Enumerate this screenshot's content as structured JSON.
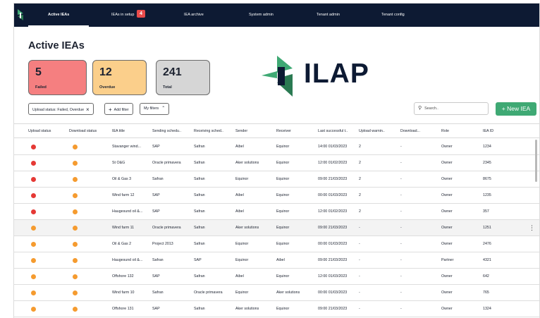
{
  "nav": {
    "tabs": [
      {
        "label": "Active IEAs"
      },
      {
        "label": "IEAs in setup",
        "badge": "4"
      },
      {
        "label": "IEA archive"
      },
      {
        "label": "System admin"
      },
      {
        "label": "Tenant admin"
      },
      {
        "label": "Tenant config"
      }
    ],
    "active_tab": "Active IEAs"
  },
  "page": {
    "title": "Active IEAs"
  },
  "stats": [
    {
      "value": "5",
      "label": "Failed",
      "color": "#f57f80"
    },
    {
      "value": "12",
      "label": "Overdue",
      "color": "#fbcf8b"
    },
    {
      "value": "241",
      "label": "Total",
      "color": "#d6d6d6"
    }
  ],
  "brand": {
    "name": "ILAP",
    "colors": {
      "green": "#3fa974",
      "dark_green": "#2a7a52",
      "navy": "#0d1a33"
    }
  },
  "filters": {
    "active_filter": "Upload status: Failed, Overdue",
    "add_filter": "Add filter",
    "my_filters": "My filters"
  },
  "search": {
    "placeholder": "Search.."
  },
  "new_button": {
    "label": "New IEA"
  },
  "status_colors": {
    "failed": "#e53935",
    "overdue": "#f59b2f"
  },
  "table": {
    "columns": [
      "Upload status",
      "Download status",
      "IEA title",
      "Sending schedu..",
      "Receiving sched..",
      "Sender",
      "Receiver",
      "Last successful t..",
      "Upload warnin..",
      "Download...",
      "Role",
      "IEA ID"
    ],
    "rows": [
      {
        "upload": "failed",
        "download": "overdue",
        "title": "Stavanger wind...",
        "sending": "SAP",
        "receiving": "Safran",
        "sender": "Aibel",
        "receiver": "Equinor",
        "last": "14:00 01/03/2023",
        "upload_warn": "2",
        "download_warn": "-",
        "role": "Owner",
        "id": "1234"
      },
      {
        "upload": "failed",
        "download": "overdue",
        "title": "St O&G",
        "sending": "Oracle primavera",
        "receiving": "Safran",
        "sender": "Aker solutions",
        "receiver": "Equinor",
        "last": "12:00 01/02/2023",
        "upload_warn": "2",
        "download_warn": "-",
        "role": "Owner",
        "id": "2345"
      },
      {
        "upload": "failed",
        "download": "overdue",
        "title": "Oil & Gas 3",
        "sending": "Safran",
        "receiving": "Safran",
        "sender": "Equinor",
        "receiver": "Equinor",
        "last": "09:00 21/03/2023",
        "upload_warn": "2",
        "download_warn": "-",
        "role": "Owner",
        "id": "8675"
      },
      {
        "upload": "failed",
        "download": "overdue",
        "title": "Wind farm 12",
        "sending": "SAP",
        "receiving": "Safran",
        "sender": "Aibel",
        "receiver": "Equinor",
        "last": "00:00 01/03/2023",
        "upload_warn": "2",
        "download_warn": "-",
        "role": "Owner",
        "id": "1235"
      },
      {
        "upload": "failed",
        "download": "overdue",
        "title": "Haugesund oil &...",
        "sending": "SAP",
        "receiving": "Safran",
        "sender": "Aibel",
        "receiver": "Equinor",
        "last": "12:00 01/02/2023",
        "upload_warn": "2",
        "download_warn": "-",
        "role": "Owner",
        "id": "357"
      },
      {
        "upload": "overdue",
        "download": "overdue",
        "title": "Wind farm 11",
        "sending": "Oracle primavera",
        "receiving": "Safran",
        "sender": "Aker solutions",
        "receiver": "Equinor",
        "last": "09:00 21/03/2023",
        "upload_warn": "-",
        "download_warn": "-",
        "role": "Owner",
        "id": "1251",
        "highlight": true
      },
      {
        "upload": "overdue",
        "download": "overdue",
        "title": "Oil & Gas 2",
        "sending": "Project 2013",
        "receiving": "Safran",
        "sender": "Equinor",
        "receiver": "Equinor",
        "last": "00:00 01/03/2023",
        "upload_warn": "-",
        "download_warn": "-",
        "role": "Owner",
        "id": "2476"
      },
      {
        "upload": "overdue",
        "download": "overdue",
        "title": "Haugesund oil &...",
        "sending": "Safran",
        "receiving": "SAP",
        "sender": "Equinor",
        "receiver": "Aibel",
        "last": "09:00 21/03/2023",
        "upload_warn": "-",
        "download_warn": "-",
        "role": "Partner",
        "id": "4321"
      },
      {
        "upload": "overdue",
        "download": "overdue",
        "title": "Offshore 132",
        "sending": "SAP",
        "receiving": "Safran",
        "sender": "Aibel",
        "receiver": "Equinor",
        "last": "12:00 01/03/2023",
        "upload_warn": "-",
        "download_warn": "-",
        "role": "Owner",
        "id": "642"
      },
      {
        "upload": "overdue",
        "download": "overdue",
        "title": "Wind farm 10",
        "sending": "Safran",
        "receiving": "Oracle primavera",
        "sender": "Equinor",
        "receiver": "Aker solutions",
        "last": "00:00 01/03/2023",
        "upload_warn": "-",
        "download_warn": "-",
        "role": "Owner",
        "id": "765"
      },
      {
        "upload": "overdue",
        "download": "overdue",
        "title": "Offshore 131",
        "sending": "SAP",
        "receiving": "Safran",
        "sender": "Aker solutions",
        "receiver": "Equinor",
        "last": "09:00 21/03/2023",
        "upload_warn": "-",
        "download_warn": "-",
        "role": "Owner",
        "id": "1324"
      }
    ]
  }
}
